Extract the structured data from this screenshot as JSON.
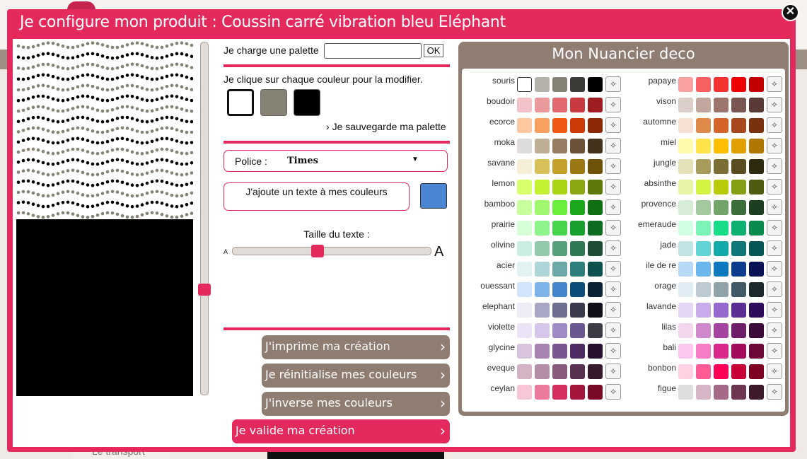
{
  "modal": {
    "title": "Je configure mon produit : Coussin carré vibration bleu Eléphant",
    "close_icon": "close-icon"
  },
  "background": {
    "footer_text": "Le transport"
  },
  "palette_loader": {
    "label": "Je charge une palette",
    "input_value": "",
    "ok_label": "OK"
  },
  "colors_section": {
    "instruction": "Je clique sur chaque couleur pour la modifier.",
    "swatches": [
      "#ffffff",
      "#858274",
      "#000000"
    ],
    "save_link": "Je sauvegarde ma palette"
  },
  "font_select": {
    "label": "Police :",
    "value": "Times"
  },
  "text_input": {
    "placeholder": "J'ajoute un texte à mes couleurs",
    "color": "#4a86d4"
  },
  "text_size": {
    "label": "Taille du texte :",
    "small_a": "A",
    "big_a": "A",
    "level": 0.43
  },
  "vertical_slider": {
    "level": 0.7
  },
  "actions": {
    "print": "J'imprime ma création",
    "reset": "Je réinitialise mes couleurs",
    "invert": "J'inverse mes couleurs",
    "validate": "Je valide ma création"
  },
  "nuancier": {
    "title": "Mon Nuancier deco",
    "left": [
      {
        "name": "souris",
        "colors": [
          "#ffffff",
          "#b3b3ab",
          "#858274",
          "#3a3a36",
          "#000000"
        ]
      },
      {
        "name": "boudoir",
        "colors": [
          "#f2c2c8",
          "#ea9a9c",
          "#e06a6e",
          "#c93a40",
          "#9e1d22"
        ]
      },
      {
        "name": "ecorce",
        "colors": [
          "#fdc7a0",
          "#f7a060",
          "#f05a14",
          "#cc3a08",
          "#8c2806"
        ]
      },
      {
        "name": "moka",
        "colors": [
          "#dedcda",
          "#bfae96",
          "#977e62",
          "#6b5239",
          "#43321c"
        ]
      },
      {
        "name": "savane",
        "colors": [
          "#f4efd6",
          "#d8c05a",
          "#c5a02c",
          "#9c7814",
          "#6e5208"
        ]
      },
      {
        "name": "lemon",
        "colors": [
          "#d8ff6c",
          "#c2f232",
          "#a8d414",
          "#8aa810",
          "#5e7a0a"
        ]
      },
      {
        "name": "bamboo",
        "colors": [
          "#c6ff9c",
          "#a0f870",
          "#6af03c",
          "#1ca81c",
          "#0e7012"
        ]
      },
      {
        "name": "prairie",
        "colors": [
          "#d6ffd8",
          "#8ef48c",
          "#48d44c",
          "#18a02e",
          "#0e6c20"
        ]
      },
      {
        "name": "olivine",
        "colors": [
          "#c9eee0",
          "#92c9ab",
          "#56a07c",
          "#2f7a52",
          "#1d4e34"
        ]
      },
      {
        "name": "acier",
        "colors": [
          "#e2f2f0",
          "#aed6d8",
          "#6ca9a8",
          "#2e7e7c",
          "#0e5250"
        ]
      },
      {
        "name": "ouessant",
        "colors": [
          "#d2e4fc",
          "#7cb4ea",
          "#4486cc",
          "#0c4e7a",
          "#0a2234"
        ]
      },
      {
        "name": "elephant",
        "colors": [
          "#ececf6",
          "#a8a8c6",
          "#6e6e90",
          "#3a3a4a",
          "#10101a"
        ]
      },
      {
        "name": "violette",
        "colors": [
          "#eae4f6",
          "#d6c6ec",
          "#a08ac6",
          "#6a5690",
          "#3e3a46"
        ]
      },
      {
        "name": "glycine",
        "colors": [
          "#d8c4dc",
          "#a884b0",
          "#7a5690",
          "#4c2c62",
          "#26102e"
        ]
      },
      {
        "name": "eveque",
        "colors": [
          "#d4b4c4",
          "#b48ea6",
          "#8a5a7c",
          "#5a3050",
          "#361a2c"
        ]
      },
      {
        "name": "ceylan",
        "colors": [
          "#f8c6d4",
          "#ec7a9c",
          "#d4305e",
          "#a4163c",
          "#780a26"
        ]
      }
    ],
    "right": [
      {
        "name": "papaye",
        "colors": [
          "#f9a0a0",
          "#f76060",
          "#f43232",
          "#ee0000",
          "#c00000"
        ]
      },
      {
        "name": "vison",
        "colors": [
          "#dccec8",
          "#c0a69c",
          "#9c766c",
          "#7a5650",
          "#5a3a36"
        ]
      },
      {
        "name": "automne",
        "colors": [
          "#f6e0d4",
          "#e08a4a",
          "#d4642a",
          "#a8481c",
          "#7a320e"
        ]
      },
      {
        "name": "miel",
        "colors": [
          "#fffcac",
          "#ffe44a",
          "#ffbf00",
          "#e0a000",
          "#b07800"
        ]
      },
      {
        "name": "jungle",
        "colors": [
          "#e4e0b8",
          "#a89c5c",
          "#7a6e34",
          "#5a4e20",
          "#2e2a10"
        ]
      },
      {
        "name": "absinthe",
        "colors": [
          "#e6f6a6",
          "#d4f444",
          "#b8cc0c",
          "#84a012",
          "#4e5a10"
        ]
      },
      {
        "name": "provence",
        "colors": [
          "#d6ecd6",
          "#a6c8a0",
          "#72a46a",
          "#3c6e3c",
          "#1e3e22"
        ]
      },
      {
        "name": "emeraude",
        "colors": [
          "#d0ffe4",
          "#7cf4b8",
          "#18dc88",
          "#0cb070",
          "#0a8a4c"
        ]
      },
      {
        "name": "jade",
        "colors": [
          "#c0e4e4",
          "#60d4d6",
          "#12aaa8",
          "#0e7878",
          "#055654"
        ]
      },
      {
        "name": "ile de re",
        "colors": [
          "#b8d8f8",
          "#6cb6ee",
          "#0e78c0",
          "#0e3c8c",
          "#0a1256"
        ]
      },
      {
        "name": "orage",
        "colors": [
          "#e2ecf4",
          "#bccad2",
          "#90a2aa",
          "#405a66",
          "#1c2a2e"
        ]
      },
      {
        "name": "lavande",
        "colors": [
          "#e6d6f6",
          "#c6acea",
          "#9468cc",
          "#5a2e92",
          "#2e0c5a"
        ]
      },
      {
        "name": "lilas",
        "colors": [
          "#f2d6ee",
          "#d088cc",
          "#a444a0",
          "#6e1e68",
          "#3c0a38"
        ]
      },
      {
        "name": "bali",
        "colors": [
          "#fdc6ec",
          "#f67cc6",
          "#d8288c",
          "#a40a5c",
          "#6e0838"
        ]
      },
      {
        "name": "bonbon",
        "colors": [
          "#fed2e2",
          "#fe5c94",
          "#fe0058",
          "#c80036",
          "#7e0020"
        ]
      },
      {
        "name": "figue",
        "colors": [
          "#dedede",
          "#d6b6c6",
          "#a46a88",
          "#6e3650",
          "#3c1a2a"
        ]
      }
    ]
  }
}
